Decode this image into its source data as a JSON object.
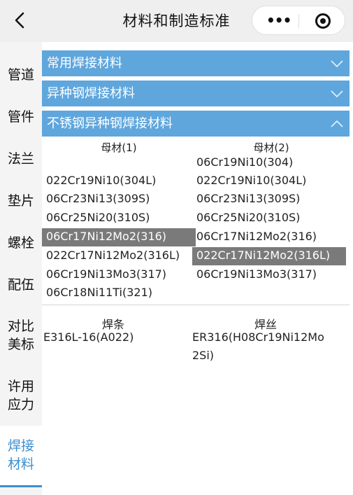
{
  "nav": {
    "title": "材料和制造标准",
    "more_icon": "more-dots-icon",
    "close_icon": "target-icon"
  },
  "sidebar": {
    "items": [
      {
        "label": "管道"
      },
      {
        "label": "管件"
      },
      {
        "label": "法兰"
      },
      {
        "label": "垫片"
      },
      {
        "label": "螺栓"
      },
      {
        "label": "配伍"
      },
      {
        "label": "对比美标"
      },
      {
        "label": "许用应力"
      },
      {
        "label": "焊接材料",
        "active": true
      }
    ]
  },
  "accordion": {
    "sections": [
      {
        "title": "常用焊接材料",
        "expanded": false
      },
      {
        "title": "异种钢焊接材料",
        "expanded": false
      },
      {
        "title": "不锈钢异种钢焊接材料",
        "expanded": true
      }
    ]
  },
  "base_metal": {
    "col1_header": "母材(1)",
    "col2_header": "母材(2)",
    "col1": [
      "022Cr19Ni10(304L)",
      "06Cr23Ni13(309S)",
      "06Cr25Ni20(310S)",
      "06Cr17Ni12Mo2(316)",
      "022Cr17Ni12Mo2(316L)",
      "06Cr19Ni13Mo3(317)",
      "06Cr18Ni11Ti(321)"
    ],
    "col2": [
      "06Cr19Ni10(304)",
      "022Cr19Ni10(304L)",
      "06Cr23Ni13(309S)",
      "06Cr25Ni20(310S)",
      "06Cr17Ni12Mo2(316)",
      "022Cr17Ni12Mo2(316L)",
      "06Cr19Ni13Mo3(317)"
    ],
    "col1_selected": "06Cr17Ni12Mo2(316)",
    "col2_selected": "022Cr17Ni12Mo2(316L)"
  },
  "result": {
    "electrode_header": "焊条",
    "wire_header": "焊丝",
    "electrode_value": "E316L-16(A022)",
    "wire_value_line1": "ER316(H08Cr19Ni12Mo",
    "wire_value_line2": "2Si)"
  },
  "colors": {
    "accent": "#3d8fd1",
    "header_bg": "#5fa6dd",
    "selected_bg": "#7a7a7a"
  }
}
